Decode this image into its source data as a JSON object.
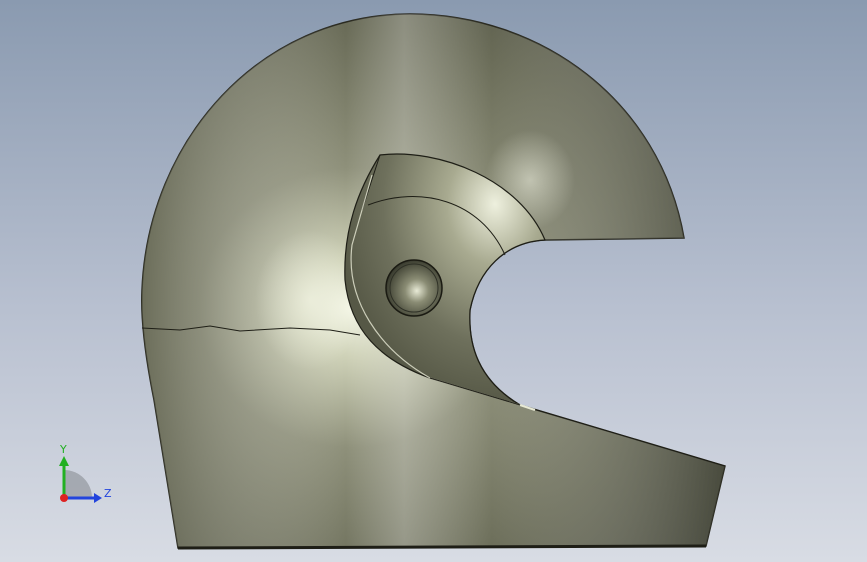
{
  "viewport": {
    "background_top": "#8a9ab0",
    "background_bottom": "#d8dce4"
  },
  "model": {
    "shell_color": "#6a6c58",
    "highlight_color": "#f4f6e8",
    "edge_color": "#1a1a14"
  },
  "triad": {
    "y_label": "Y",
    "z_label": "Z",
    "y_color": "#22b022",
    "z_color": "#2244dd",
    "x_color": "#dd2222"
  }
}
